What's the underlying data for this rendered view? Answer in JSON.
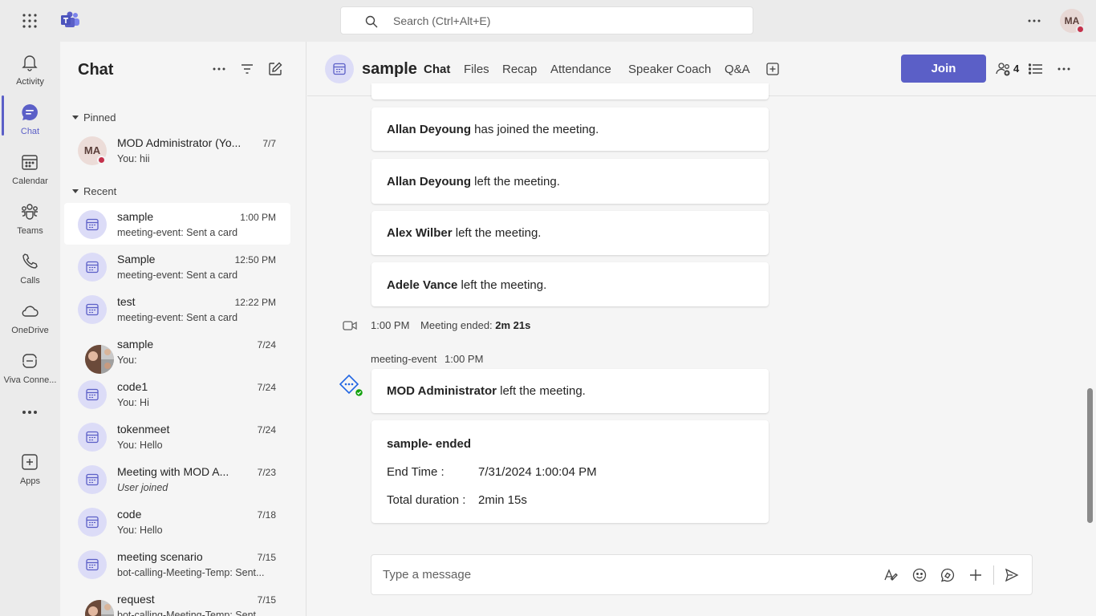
{
  "topbar": {
    "search_placeholder": "Search (Ctrl+Alt+E)",
    "user_initials": "MA"
  },
  "rail": {
    "items": [
      {
        "label": "Activity",
        "icon": "bell-icon"
      },
      {
        "label": "Chat",
        "icon": "chat-icon"
      },
      {
        "label": "Calendar",
        "icon": "calendar-icon"
      },
      {
        "label": "Teams",
        "icon": "teams-icon"
      },
      {
        "label": "Calls",
        "icon": "phone-icon"
      },
      {
        "label": "OneDrive",
        "icon": "cloud-icon"
      },
      {
        "label": "Viva Conne...",
        "icon": "viva-icon"
      },
      {
        "label": "Apps",
        "icon": "apps-icon"
      }
    ],
    "more": "..."
  },
  "chatlist": {
    "title": "Chat",
    "pinned_label": "Pinned",
    "recent_label": "Recent",
    "pinned": [
      {
        "initials": "MA",
        "name": "MOD Administrator (Yo...",
        "time": "7/7",
        "preview": "You: hii"
      }
    ],
    "recent": [
      {
        "name": "sample",
        "time": "1:00 PM",
        "preview": "meeting-event: Sent a card",
        "avatar": "meeting"
      },
      {
        "name": "Sample",
        "time": "12:50 PM",
        "preview": "meeting-event: Sent a card",
        "avatar": "meeting"
      },
      {
        "name": "test",
        "time": "12:22 PM",
        "preview": "meeting-event: Sent a card",
        "avatar": "meeting"
      },
      {
        "name": "sample",
        "time": "7/24",
        "preview": "You:",
        "avatar": "photo"
      },
      {
        "name": "code1",
        "time": "7/24",
        "preview": "You: Hi",
        "avatar": "meeting"
      },
      {
        "name": "tokenmeet",
        "time": "7/24",
        "preview": "You: Hello",
        "avatar": "meeting"
      },
      {
        "name": "Meeting with MOD A...",
        "time": "7/23",
        "preview": "User joined",
        "avatar": "meeting"
      },
      {
        "name": "code",
        "time": "7/18",
        "preview": "You: Hello",
        "avatar": "meeting"
      },
      {
        "name": "meeting scenario",
        "time": "7/15",
        "preview": "bot-calling-Meeting-Temp: Sent...",
        "avatar": "meeting"
      },
      {
        "name": "request",
        "time": "7/15",
        "preview": "bot-calling-Meeting-Temp: Sent...",
        "avatar": "photo"
      }
    ]
  },
  "header": {
    "title": "sample",
    "tabs": [
      "Chat",
      "Files",
      "Recap",
      "Attendance",
      "Speaker Coach",
      "Q&A"
    ],
    "join_label": "Join",
    "participants": "4"
  },
  "messages": {
    "events": [
      {
        "name": "Allan Deyoung",
        "text": " has joined the meeting."
      },
      {
        "name": "Allan Deyoung",
        "text": " left the meeting."
      },
      {
        "name": "Alex Wilber",
        "text": " left the meeting."
      },
      {
        "name": "Adele Vance",
        "text": " left the meeting."
      }
    ],
    "meeting_ended": {
      "time": "1:00 PM",
      "label": "Meeting ended: ",
      "duration": "2m 21s"
    },
    "bot": {
      "sender": "meeting-event",
      "time": "1:00 PM"
    },
    "bot_event": {
      "name": "MOD Administrator",
      "text": " left the meeting."
    },
    "summary_card": {
      "title": "sample- ended",
      "end_label": "End Time :",
      "end_value": "7/31/2024 1:00:04 PM",
      "duration_label": "Total duration :",
      "duration_value": "2min 15s"
    }
  },
  "composer": {
    "placeholder": "Type a message"
  },
  "colors": {
    "accent": "#5b5fc7",
    "presence_busy": "#c4314b"
  }
}
